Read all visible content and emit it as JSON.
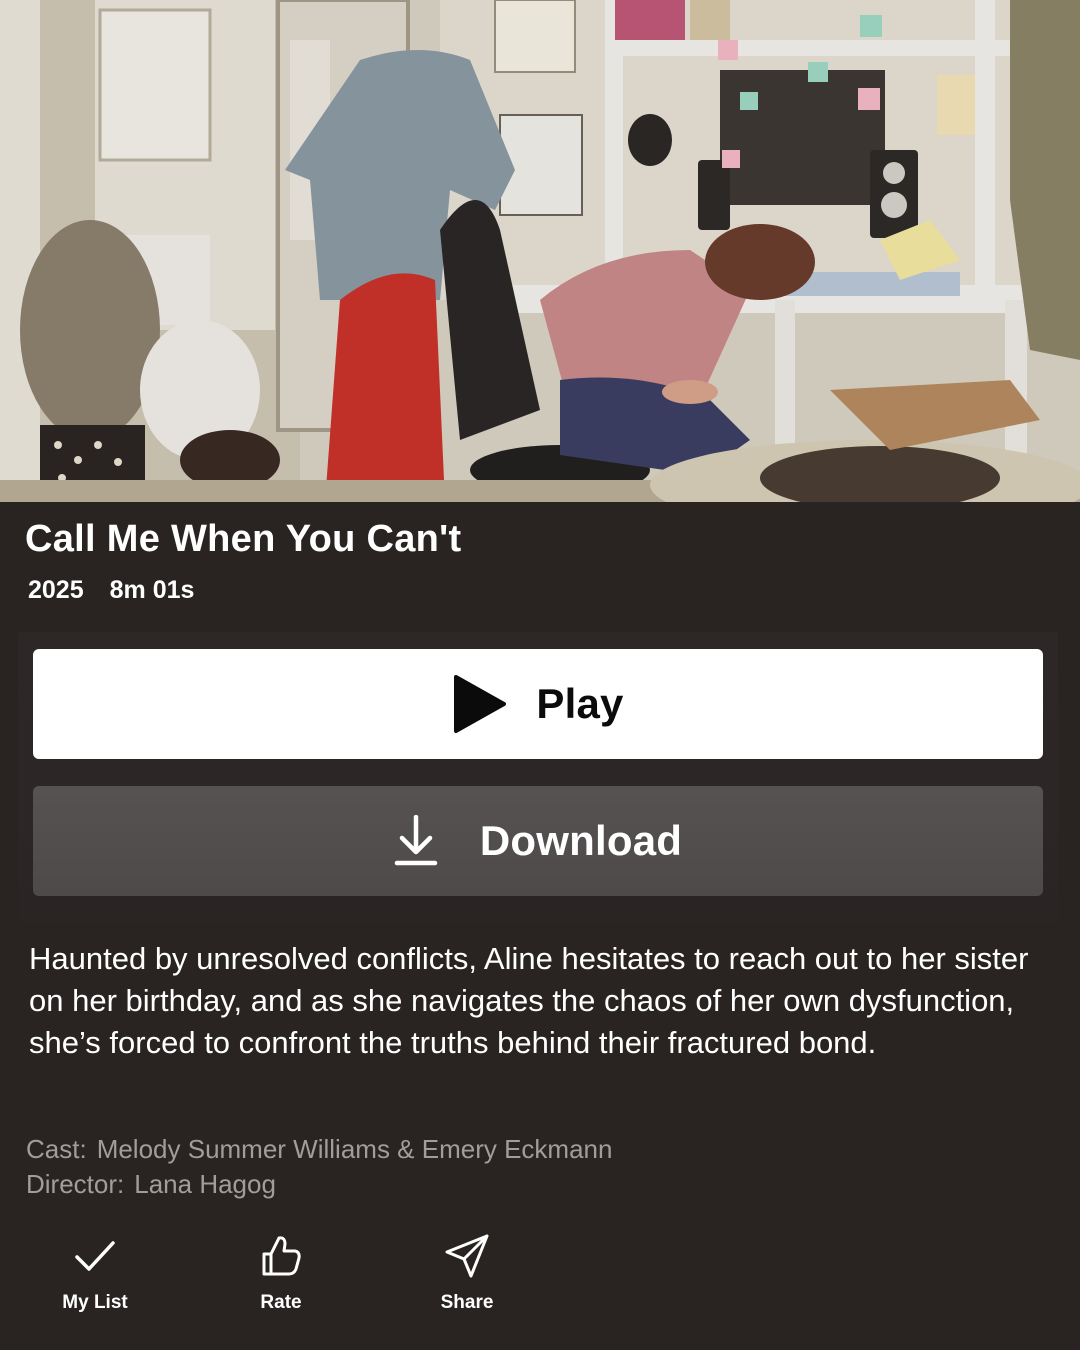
{
  "hero": {
    "image_description": "Still of a young woman slumped over a cluttered desk in a messy bedroom, gaming chair draped with clothes"
  },
  "movie": {
    "title": "Call Me When You Can't",
    "year": "2025",
    "duration": "8m 01s",
    "description": "Haunted by unresolved conflicts, Aline hesitates to reach out to her sister on her birthday, and as she navigates the chaos of her own dysfunction, she’s forced to confront the truths behind their fractured bond.",
    "cast_label": "Cast:",
    "cast": "Melody Summer Williams & Emery Eckmann",
    "director_label": "Director:",
    "director": "Lana Hagog"
  },
  "buttons": {
    "play_label": "Play",
    "play_icon": "play-icon",
    "download_label": "Download",
    "download_icon": "download-icon"
  },
  "toolbar": {
    "items": [
      {
        "label": "My List",
        "icon": "check-icon"
      },
      {
        "label": "Rate",
        "icon": "thumbs-up-icon"
      },
      {
        "label": "Share",
        "icon": "send-icon"
      }
    ]
  },
  "colors": {
    "background": "#292422",
    "play_button": "#ffffff",
    "download_button": "#525050",
    "secondary_text": "#a19d9b"
  }
}
